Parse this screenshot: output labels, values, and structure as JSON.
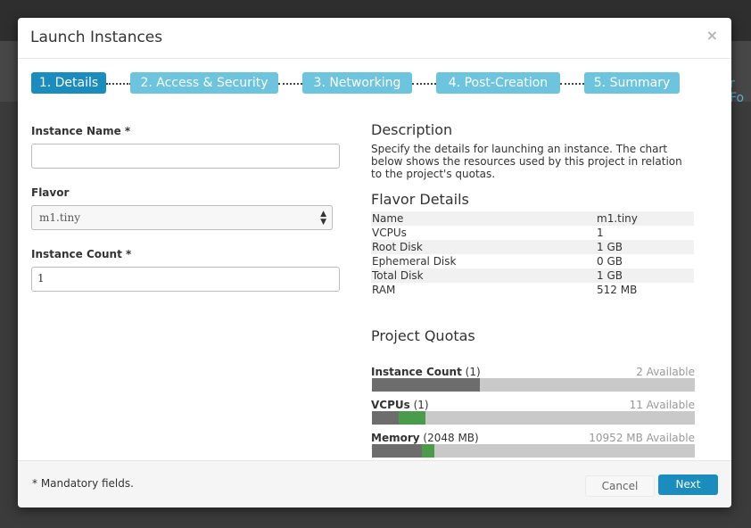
{
  "background": {
    "peek_text": "r Fo"
  },
  "modal": {
    "title": "Launch Instances",
    "close_symbol": "×",
    "wizard_steps": [
      {
        "label": "1. Details",
        "active": true
      },
      {
        "label": "2. Access & Security",
        "active": false
      },
      {
        "label": "3. Networking",
        "active": false
      },
      {
        "label": "4. Post-Creation",
        "active": false
      },
      {
        "label": "5. Summary",
        "active": false
      }
    ],
    "form": {
      "instance_name_label": "Instance Name *",
      "instance_name_value": "",
      "flavor_label": "Flavor",
      "flavor_value": "m1.tiny",
      "instance_count_label": "Instance Count *",
      "instance_count_value": "1"
    },
    "description": {
      "heading": "Description",
      "text": "Specify the details for launching an instance. The chart below shows the resources used by this project in relation to the project's quotas."
    },
    "flavor_details": {
      "heading": "Flavor Details",
      "rows": [
        {
          "key": "Name",
          "value": "m1.tiny"
        },
        {
          "key": "VCPUs",
          "value": "1"
        },
        {
          "key": "Root Disk",
          "value": "1 GB"
        },
        {
          "key": "Ephemeral Disk",
          "value": "0 GB"
        },
        {
          "key": "Total Disk",
          "value": "1 GB"
        },
        {
          "key": "RAM",
          "value": "512 MB"
        }
      ]
    },
    "quotas": {
      "heading": "Project Quotas",
      "items": [
        {
          "name": "Instance Count",
          "detail": "(1)",
          "available": "2 Available",
          "used_fraction": 0.333,
          "added_fraction": 0.0
        },
        {
          "name": "VCPUs",
          "detail": "(1)",
          "available": "11 Available",
          "used_fraction": 0.083,
          "added_fraction": 0.083
        },
        {
          "name": "Memory",
          "detail": "(2048 MB)",
          "available": "10952 MB Available",
          "used_fraction": 0.156,
          "added_fraction": 0.039
        }
      ]
    },
    "footer": {
      "mandatory_note": "* Mandatory fields.",
      "cancel_label": "Cancel",
      "next_label": "Next"
    },
    "colors": {
      "wizard_active": "#1a8cbd",
      "wizard_inactive": "#6cc4de",
      "quota_used": "#6d6d6d",
      "quota_added": "#4a9b4a",
      "quota_track": "#c9c9c9"
    }
  }
}
